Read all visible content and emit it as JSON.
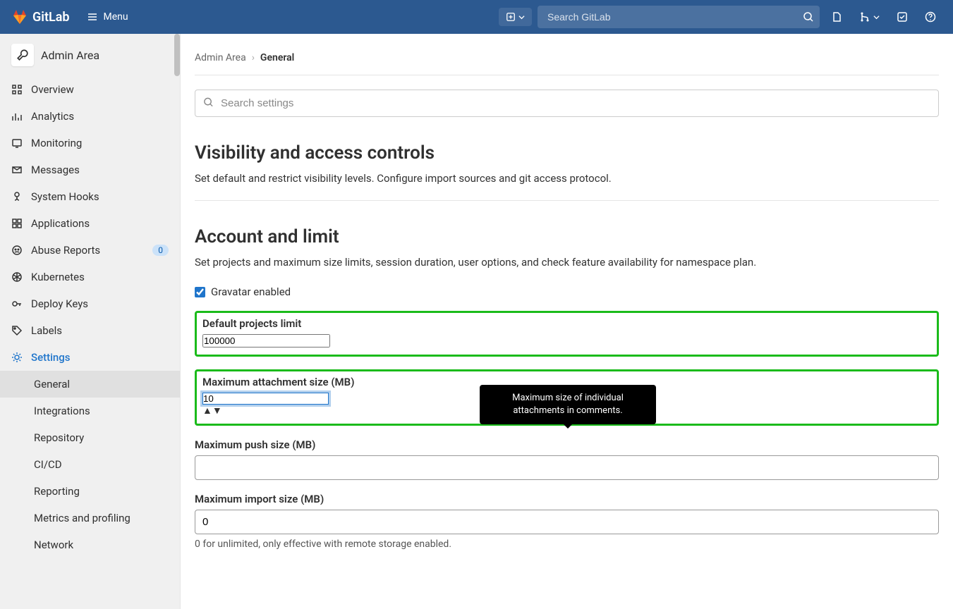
{
  "header": {
    "brand": "GitLab",
    "menu_label": "Menu",
    "search_placeholder": "Search GitLab"
  },
  "sidebar": {
    "title": "Admin Area",
    "items": [
      {
        "label": "Overview",
        "icon": "overview"
      },
      {
        "label": "Analytics",
        "icon": "analytics"
      },
      {
        "label": "Monitoring",
        "icon": "monitoring"
      },
      {
        "label": "Messages",
        "icon": "messages"
      },
      {
        "label": "System Hooks",
        "icon": "hooks"
      },
      {
        "label": "Applications",
        "icon": "applications"
      },
      {
        "label": "Abuse Reports",
        "icon": "abuse",
        "badge": "0"
      },
      {
        "label": "Kubernetes",
        "icon": "kubernetes"
      },
      {
        "label": "Deploy Keys",
        "icon": "deploykeys"
      },
      {
        "label": "Labels",
        "icon": "labels"
      },
      {
        "label": "Settings",
        "icon": "settings",
        "active": true
      }
    ],
    "subitems": [
      {
        "label": "General",
        "selected": true
      },
      {
        "label": "Integrations"
      },
      {
        "label": "Repository"
      },
      {
        "label": "CI/CD"
      },
      {
        "label": "Reporting"
      },
      {
        "label": "Metrics and profiling"
      },
      {
        "label": "Network"
      }
    ]
  },
  "breadcrumb": {
    "parent": "Admin Area",
    "current": "General"
  },
  "settings_search_placeholder": "Search settings",
  "sections": {
    "visibility": {
      "title": "Visibility and access controls",
      "desc": "Set default and restrict visibility levels. Configure import sources and git access protocol."
    },
    "account": {
      "title": "Account and limit",
      "desc": "Set projects and maximum size limits, session duration, user options, and check feature availability for namespace plan.",
      "gravatar_label": "Gravatar enabled",
      "gravatar_checked": true,
      "default_projects_label": "Default projects limit",
      "default_projects_value": "100000",
      "max_attachment_label": "Maximum attachment size (MB)",
      "max_attachment_value": "10",
      "max_push_label": "Maximum push size (MB)",
      "max_push_value": "",
      "max_import_label": "Maximum import size (MB)",
      "max_import_value": "0",
      "max_import_help": "0 for unlimited, only effective with remote storage enabled."
    }
  },
  "tooltip": "Maximum size of individual attachments in comments."
}
